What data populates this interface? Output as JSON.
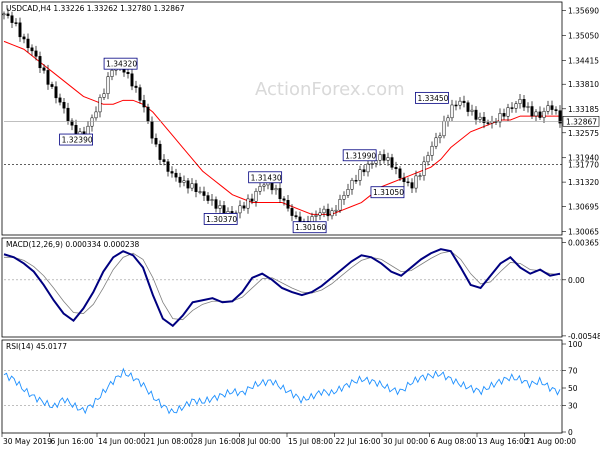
{
  "chart_data": [
    {
      "type": "candlestick",
      "header": "USDCAD,H4  1.33226 1.33262 1.32780 1.32867",
      "watermark": "ActionForex.com",
      "ylim": [
        1.3,
        1.358
      ],
      "yticks": [
        "1.35690",
        "1.35050",
        "1.34415",
        "1.33810",
        "1.33185",
        "1.32575",
        "1.31940",
        "1.31320",
        "1.30695",
        "1.30065"
      ],
      "current_price": "1.32867",
      "level_line": "1.31770",
      "level_value": 1.3177,
      "annotations": [
        {
          "text": "1.34320",
          "x": 0.18,
          "y": 1.3432
        },
        {
          "text": "1.32390",
          "x": 0.1,
          "y": 1.3239
        },
        {
          "text": "1.31430",
          "x": 0.44,
          "y": 1.3143
        },
        {
          "text": "1.30370",
          "x": 0.36,
          "y": 1.3037
        },
        {
          "text": "1.30160",
          "x": 0.52,
          "y": 1.3016
        },
        {
          "text": "1.31990",
          "x": 0.61,
          "y": 1.3199
        },
        {
          "text": "1.31050",
          "x": 0.66,
          "y": 1.3105
        },
        {
          "text": "1.33450",
          "x": 0.74,
          "y": 1.3345
        }
      ],
      "price_path": [
        1.356,
        1.354,
        1.349,
        1.346,
        1.341,
        1.336,
        1.332,
        1.326,
        1.325,
        1.33,
        1.336,
        1.343,
        1.342,
        1.338,
        1.333,
        1.324,
        1.318,
        1.315,
        1.313,
        1.312,
        1.31,
        1.308,
        1.306,
        1.305,
        1.307,
        1.309,
        1.313,
        1.312,
        1.309,
        1.305,
        1.302,
        1.304,
        1.306,
        1.305,
        1.309,
        1.313,
        1.316,
        1.318,
        1.32,
        1.318,
        1.314,
        1.312,
        1.316,
        1.322,
        1.326,
        1.332,
        1.334,
        1.331,
        1.329,
        1.328,
        1.33,
        1.332,
        1.334,
        1.331,
        1.33,
        1.333,
        1.329
      ],
      "ma_path": [
        1.349,
        1.348,
        1.347,
        1.345,
        1.343,
        1.341,
        1.339,
        1.337,
        1.335,
        1.334,
        1.333,
        1.333,
        1.334,
        1.334,
        1.333,
        1.331,
        1.328,
        1.325,
        1.322,
        1.319,
        1.316,
        1.314,
        1.312,
        1.31,
        1.309,
        1.308,
        1.308,
        1.308,
        1.308,
        1.307,
        1.306,
        1.305,
        1.305,
        1.305,
        1.306,
        1.307,
        1.308,
        1.31,
        1.312,
        1.313,
        1.314,
        1.315,
        1.316,
        1.317,
        1.319,
        1.322,
        1.324,
        1.326,
        1.327,
        1.328,
        1.329,
        1.329,
        1.33,
        1.33,
        1.33,
        1.33,
        1.33
      ]
    },
    {
      "type": "line",
      "header": "MACD(12,26,9) 0.000334 0.000238",
      "ylim": [
        -0.0055,
        0.0037
      ],
      "yticks": [
        "0.003651",
        "0.00",
        "-0.005489"
      ],
      "macd": [
        0.0025,
        0.0022,
        0.0016,
        0.0008,
        -0.0005,
        -0.002,
        -0.0033,
        -0.004,
        -0.0028,
        -0.0012,
        0.0008,
        0.0022,
        0.0028,
        0.0024,
        0.0012,
        -0.0015,
        -0.0038,
        -0.0045,
        -0.0035,
        -0.0022,
        -0.002,
        -0.0018,
        -0.0022,
        -0.0021,
        -0.0012,
        0.0002,
        0.0006,
        0.0,
        -0.0008,
        -0.0012,
        -0.0015,
        -0.0012,
        -0.0006,
        0.0002,
        0.001,
        0.0018,
        0.0024,
        0.0022,
        0.0016,
        0.0008,
        0.0004,
        0.0012,
        0.002,
        0.0026,
        0.003,
        0.0028,
        0.0012,
        -0.0005,
        -0.0008,
        0.0004,
        0.0016,
        0.0022,
        0.0012,
        0.0006,
        0.001,
        0.0004,
        0.0006
      ],
      "signal": [
        0.0022,
        0.0022,
        0.0019,
        0.0013,
        0.0004,
        -0.0008,
        -0.0021,
        -0.0032,
        -0.0033,
        -0.0024,
        -0.0008,
        0.001,
        0.0022,
        0.0026,
        0.002,
        0.0002,
        -0.0022,
        -0.0038,
        -0.0039,
        -0.003,
        -0.0024,
        -0.0021,
        -0.0021,
        -0.0021,
        -0.0017,
        -0.0008,
        0.0001,
        0.0002,
        -0.0003,
        -0.0008,
        -0.0012,
        -0.0013,
        -0.001,
        -0.0004,
        0.0004,
        0.0012,
        0.0019,
        0.0022,
        0.002,
        0.0014,
        0.0008,
        0.0009,
        0.0015,
        0.0021,
        0.0026,
        0.0028,
        0.002,
        0.0006,
        -0.0004,
        -0.0002,
        0.0008,
        0.0017,
        0.0016,
        0.001,
        0.0009,
        0.0006,
        0.0005
      ]
    },
    {
      "type": "line",
      "header": "RSI(14) 45.0177",
      "ylim": [
        0,
        100
      ],
      "yticks": [
        "100",
        "70",
        "50",
        "30",
        "0"
      ],
      "levels": [
        70,
        30
      ],
      "rsi": [
        65,
        60,
        48,
        40,
        34,
        28,
        38,
        30,
        24,
        32,
        45,
        58,
        68,
        62,
        54,
        40,
        30,
        22,
        28,
        36,
        34,
        38,
        42,
        46,
        44,
        52,
        56,
        58,
        50,
        44,
        36,
        40,
        46,
        44,
        50,
        56,
        60,
        58,
        54,
        48,
        46,
        56,
        62,
        64,
        66,
        60,
        54,
        50,
        46,
        52,
        58,
        62,
        60,
        54,
        58,
        50,
        45
      ]
    }
  ],
  "x_axis": {
    "labels": [
      "30 May 2019",
      "6 Jun 16:00",
      "14 Jun 00:00",
      "21 Jun 08:00",
      "28 Jun 16:00",
      "8 Jul 00:00",
      "15 Jul 08:00",
      "22 Jul 16:00",
      "30 Jul 00:00",
      "6 Aug 08:00",
      "13 Aug 16:00",
      "21 Aug 00:00"
    ]
  },
  "colors": {
    "price": "#000000",
    "ma": "#ff0000",
    "macd": "#000080",
    "signal": "#808080",
    "rsi": "#1e90ff",
    "level_line": "#000000",
    "annot_border": "#000080"
  }
}
